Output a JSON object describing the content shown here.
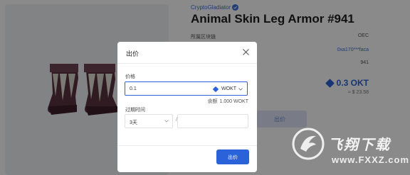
{
  "nft": {
    "collection": "CryptoGladiator",
    "title": "Animal Skin Leg Armor #941",
    "info_rows": [
      {
        "label": "所属区块链",
        "value": "OEC"
      },
      {
        "label": "",
        "value": "0xa170***faca"
      },
      {
        "label": "",
        "value": "941"
      }
    ],
    "price": "0.3 OKT",
    "price_usd": "≈ $ 23.58",
    "bid_button": "出价"
  },
  "modal": {
    "title": "出价",
    "price_label": "价格",
    "price_value": "0.1",
    "currency": "WOKT",
    "balance_label": "余额",
    "balance_value": "1.000 WOKT",
    "expiry_label": "过期时间",
    "expiry_value": "3天",
    "separator": "/",
    "submit_label": "出价"
  },
  "watermark": {
    "title": "飞翔下载",
    "url": "www.FXXZ.com"
  },
  "colors": {
    "accent": "#2b62d9",
    "link": "#3b6fd6",
    "overlay": "rgba(0,0,0,0.46)"
  },
  "icons": [
    "verified-icon",
    "close-icon",
    "okt-token-icon",
    "chevron-down-icon"
  ]
}
